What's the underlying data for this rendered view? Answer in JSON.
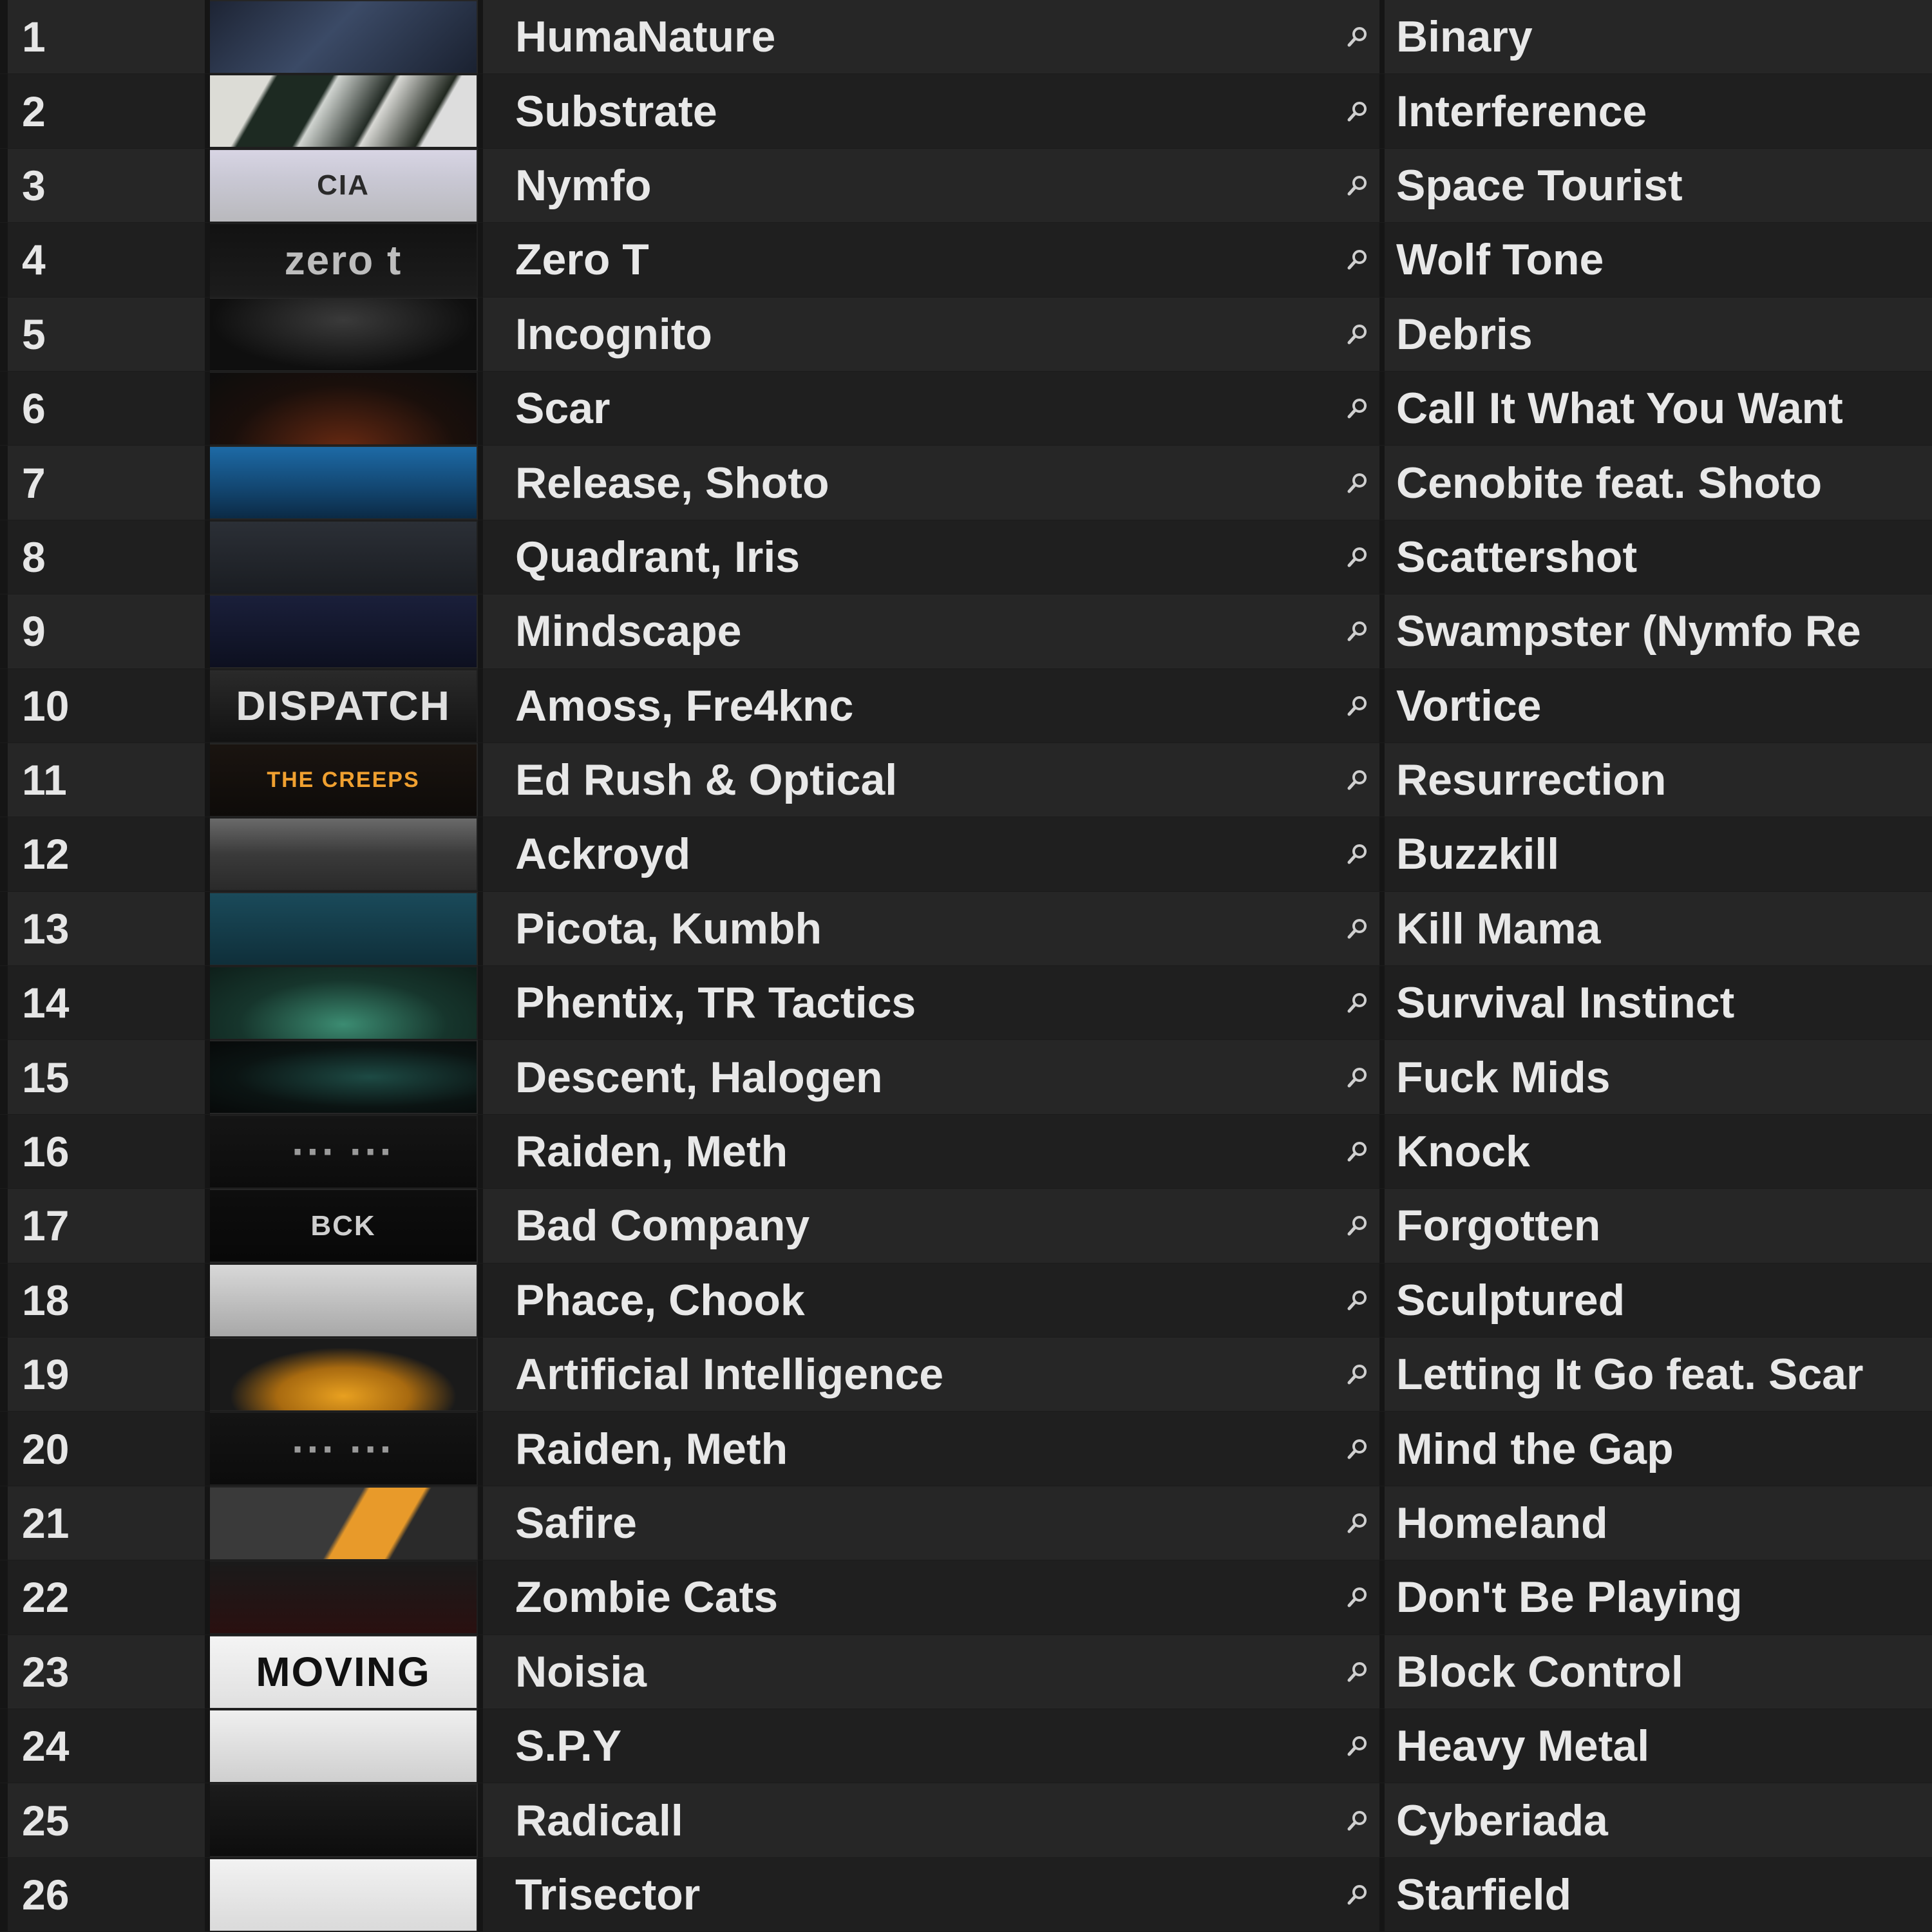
{
  "rows": [
    {
      "num": "1",
      "artist": "HumaNature",
      "title": "Binary",
      "art": {
        "bg": "linear-gradient(135deg,#1d2434,#3b4a66 45%,#1a2130)",
        "text": "",
        "color": "#ffffff"
      }
    },
    {
      "num": "2",
      "artist": "Substrate",
      "title": "Interference",
      "art": {
        "bg": "linear-gradient(120deg,#dcdcd6 0%,#dcdcd6 20%,#1d2a22 22%,#1d2a22 40%,#cfd3cf 42%,#232b25 60%,#d8d8d4 62%,#20271f 80%,#dddddd 82%)",
        "text": "",
        "color": "#ffffff"
      }
    },
    {
      "num": "3",
      "artist": "Nymfo",
      "title": "Space Tourist",
      "art": {
        "bg": "linear-gradient(180deg,#d8d5e4,#c9c8d4 40%,#b9b9bd)",
        "text": "CIA",
        "color": "#2a2a2a"
      }
    },
    {
      "num": "4",
      "artist": "Zero T",
      "title": "Wolf Tone",
      "art": {
        "bg": "linear-gradient(180deg,#121212,#1c1c1c)",
        "text": "zero t",
        "color": "#bdbdbd"
      }
    },
    {
      "num": "5",
      "artist": "Incognito",
      "title": "Debris",
      "art": {
        "bg": "radial-gradient(ellipse at 50% 30%,#3a3a3a,#0f0f0f 70%)",
        "text": "",
        "color": "#ffffff"
      }
    },
    {
      "num": "6",
      "artist": "Scar",
      "title": "Call It What You Want",
      "art": {
        "bg": "radial-gradient(ellipse at 50% 110%,#6a2a12,#1a0f0b 60%,#0d0d0d)",
        "text": "",
        "color": "#ffffff"
      }
    },
    {
      "num": "7",
      "artist": "Release, Shoto",
      "title": "Cenobite feat. Shoto",
      "art": {
        "bg": "linear-gradient(180deg,#1d6aa6,#12456f 60%,#0b2a45)",
        "text": "",
        "color": "#ffffff"
      }
    },
    {
      "num": "8",
      "artist": "Quadrant, Iris",
      "title": "Scattershot",
      "art": {
        "bg": "linear-gradient(180deg,#2b2f36,#1a1d22)",
        "text": "",
        "color": "#ffffff"
      }
    },
    {
      "num": "9",
      "artist": "Mindscape",
      "title": "Swampster (Nymfo Re",
      "art": {
        "bg": "linear-gradient(180deg,#1a1f3a,#0d1020)",
        "text": "",
        "color": "#ffffff"
      }
    },
    {
      "num": "10",
      "artist": "Amoss, Fre4knc",
      "title": "Vortice",
      "art": {
        "bg": "linear-gradient(180deg,#2a2a2a,#121212)",
        "text": "DISPATCH",
        "color": "#e0e0e0"
      }
    },
    {
      "num": "11",
      "artist": "Ed Rush & Optical",
      "title": "Resurrection",
      "art": {
        "bg": "linear-gradient(180deg,#1a1410,#0e0b09)",
        "text": "THE CREEPS",
        "color": "#f0a030"
      }
    },
    {
      "num": "12",
      "artist": "Ackroyd",
      "title": "Buzzkill",
      "art": {
        "bg": "linear-gradient(180deg,#6a6a6a,#3a3a3a 50%,#2a2a2a)",
        "text": "",
        "color": "#ffffff"
      }
    },
    {
      "num": "13",
      "artist": "Picota, Kumbh",
      "title": "Kill Mama",
      "art": {
        "bg": "linear-gradient(180deg,#1a4a5a,#0f2f3a)",
        "text": "",
        "color": "#ffffff"
      }
    },
    {
      "num": "14",
      "artist": "Phentix, TR Tactics",
      "title": "Survival Instinct",
      "art": {
        "bg": "radial-gradient(ellipse at 50% 80%,#3c8c72,#16352c 55%,#0e1f1a)",
        "text": "",
        "color": "#ffffff"
      }
    },
    {
      "num": "15",
      "artist": "Descent, Halogen",
      "title": "Fuck Mids",
      "art": {
        "bg": "radial-gradient(ellipse at 60% 50%,#1d4a44,#0b1413 60%,#070909)",
        "text": "",
        "color": "#ffffff"
      }
    },
    {
      "num": "16",
      "artist": "Raiden, Meth",
      "title": "Knock",
      "art": {
        "bg": "linear-gradient(180deg,#151515,#0c0c0c)",
        "text": "··· ···",
        "color": "#9a9a9a"
      }
    },
    {
      "num": "17",
      "artist": "Bad Company",
      "title": "Forgotten",
      "art": {
        "bg": "linear-gradient(180deg,#0e0e0e,#080808)",
        "text": "BCK",
        "color": "#cfcfcf"
      }
    },
    {
      "num": "18",
      "artist": "Phace, Chook",
      "title": "Sculptured",
      "art": {
        "bg": "linear-gradient(180deg,#d8d8d8,#a8a8a8)",
        "text": "",
        "color": "#ffffff"
      }
    },
    {
      "num": "19",
      "artist": "Artificial Intelligence",
      "title": "Letting It Go feat. Scar",
      "art": {
        "bg": "radial-gradient(ellipse at 50% 80%,#e8a020,#a86a10 35%,#1a1a1a 60%)",
        "text": "",
        "color": "#ffffff"
      }
    },
    {
      "num": "20",
      "artist": "Raiden, Meth",
      "title": "Mind the Gap",
      "art": {
        "bg": "linear-gradient(180deg,#141414,#0c0c0c)",
        "text": "··· ···",
        "color": "#9a9a9a"
      }
    },
    {
      "num": "21",
      "artist": "Safire",
      "title": "Homeland",
      "art": {
        "bg": "linear-gradient(120deg,#3a3a3a 0%,#3a3a3a 50%,#e89a2a 52%,#e89a2a 70%,#2a2a2a 72%)",
        "text": "",
        "color": "#ffffff"
      }
    },
    {
      "num": "22",
      "artist": "Zombie Cats",
      "title": "Don't Be Playing",
      "art": {
        "bg": "linear-gradient(180deg,#1a1a1a,#2a1010)",
        "text": "",
        "color": "#ffffff"
      }
    },
    {
      "num": "23",
      "artist": "Noisia",
      "title": "Block Control",
      "art": {
        "bg": "linear-gradient(180deg,#f4f4f4,#e0e0e0)",
        "text": "MOVING",
        "color": "#111111"
      }
    },
    {
      "num": "24",
      "artist": "S.P.Y",
      "title": "Heavy Metal",
      "art": {
        "bg": "linear-gradient(180deg,#efefef,#cfcfcf)",
        "text": "",
        "color": "#ffffff"
      }
    },
    {
      "num": "25",
      "artist": "Radicall",
      "title": "Cyberiada",
      "art": {
        "bg": "linear-gradient(180deg,#1c1c1c,#0d0d0d)",
        "text": "",
        "color": "#ffffff"
      }
    },
    {
      "num": "26",
      "artist": "Trisector",
      "title": "Starfield",
      "art": {
        "bg": "linear-gradient(180deg,#f2f2f2,#dadada)",
        "text": "",
        "color": "#ffffff"
      }
    }
  ],
  "icons": {
    "search": "search-icon"
  },
  "colors": {
    "row_odd": "#262626",
    "row_even": "#1f1f1f",
    "text": "#e8e8e8",
    "icon": "#cfcfcf"
  }
}
